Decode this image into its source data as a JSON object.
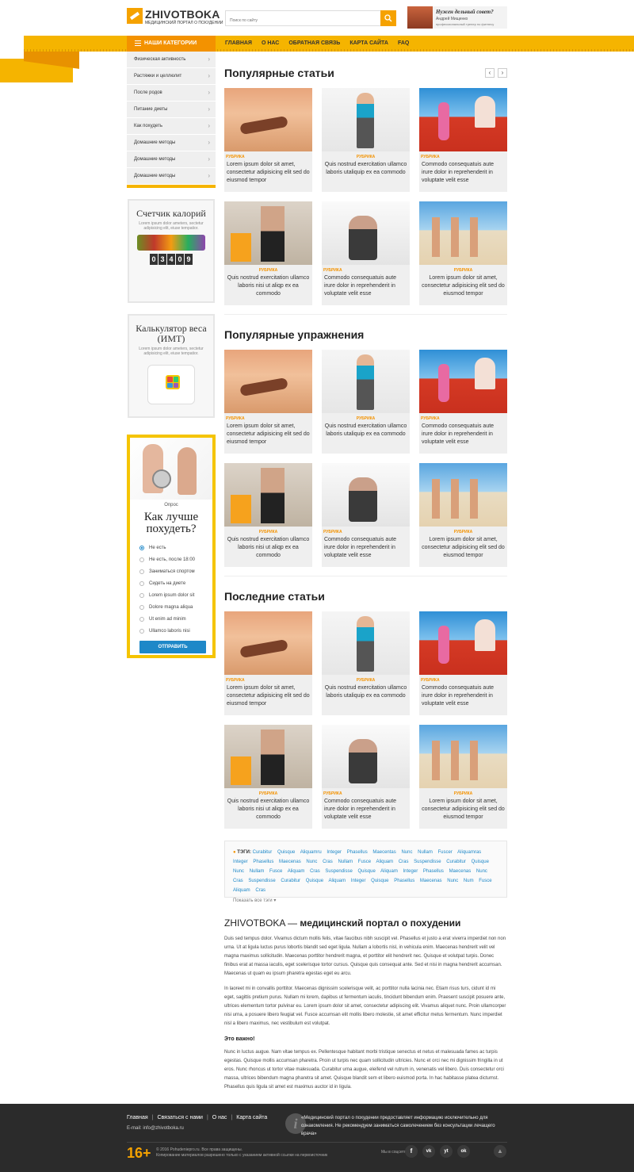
{
  "header": {
    "logo_name": "ZHIVOTBOKA",
    "logo_tagline": "МЕДИЦИНСКИЙ ПОРТАЛ О ПОХУДЕНИИ",
    "search_placeholder": "Поиск по сайту",
    "promo_title": "Нужен дельный совет?",
    "promo_name": "Андрей Мищенко",
    "promo_role": "профессиональный тренер по фитнесу"
  },
  "nav": {
    "categories_label": "НАШИ КАТЕГОРИИ",
    "items": [
      "ГЛАВНАЯ",
      "О НАС",
      "ОБРАТНАЯ СВЯЗЬ",
      "КАРТА САЙТА",
      "FAQ"
    ]
  },
  "categories": [
    "Физическая активность",
    "Растяжки и целлюлит",
    "После родов",
    "Питание диеты",
    "Как похудеть",
    "Домашние методы",
    "Домашние методы",
    "Домашние методы"
  ],
  "widgets": {
    "calories": {
      "title": "Счетчик калорий",
      "desc": "Lorem ipsum dolor ameters, sectetur adipisicing elit, eiuse tempatior.",
      "counter": [
        "0",
        "3",
        "4",
        "0",
        "9"
      ]
    },
    "bmi": {
      "title": "Калькулятор веса (ИМТ)",
      "desc": "Lorem ipsum dolor ameters, sectetur adipisicing elit, eiuse tempatior."
    }
  },
  "poll": {
    "label": "Опрос",
    "question": "Как лучше похудеть?",
    "options": [
      "Не есть",
      "Не есть, после 18:00",
      "Заниматься спортом",
      "Сидеть на диете",
      "Lorem ipsum dolor sit",
      "Dolore magna aliqua",
      "Ut enim ad minim",
      "Ullamco laboris nisi"
    ],
    "selected": 0,
    "submit": "ОТПРАВИТЬ"
  },
  "sections": [
    {
      "title": "Популярные статьи",
      "has_arrows": true
    },
    {
      "title": "Популярные упражнения",
      "has_arrows": false
    },
    {
      "title": "Последние статьи",
      "has_arrows": false
    }
  ],
  "arrows": {
    "prev": "‹",
    "next": "›"
  },
  "cards": [
    {
      "image": "beach",
      "rubric": "РУБРИКА",
      "text": "Lorem ipsum dolor sit amet, consectetur adipisicing elit sed do eiusmod tempor",
      "align": "left"
    },
    {
      "image": "gym",
      "rubric": "РУБРИКА",
      "text": "Quis nostrud exercitation ullamco laboris utaliquip ex ea commodo",
      "align": "center"
    },
    {
      "image": "track",
      "rubric": "РУБРИКА",
      "text": "Commodo consequatuis aute irure dolor in reprehenderit in voluptate velit esse",
      "align": "left"
    },
    {
      "image": "food",
      "rubric": "РУБРИКА",
      "text": "Quis nostrud exercitation ullamco laboris nisi ut aliqp ex ea commodo",
      "align": "center"
    },
    {
      "image": "home",
      "rubric": "РУБРИКА",
      "text": "Commodo consequatuis aute irure dolor in reprehenderit in voluptate velit esse",
      "align": "left"
    },
    {
      "image": "sea",
      "rubric": "РУБРИКА",
      "text": "Lorem ipsum dolor sit amet, consectetur adipisicing elit sed do eiusmod tempor",
      "align": "center"
    }
  ],
  "tags": {
    "label": "ТЭГИ:",
    "items": [
      "Curabitur",
      "Quisque",
      "Aliquamru",
      "Integer",
      "Phasellus",
      "Maecentas",
      "Nunc",
      "Nullam",
      "Fuscer",
      "Aliquamras",
      "Integer",
      "Phasellus",
      "Maecenas",
      "Nunc",
      "Cras",
      "Nullam",
      "Fusce",
      "Aliquam",
      "Cras",
      "Suspendisse",
      "Curabitur",
      "Quisque",
      "Nunc",
      "Nullam",
      "Fusce",
      "Aliquam",
      "Cras",
      "Suspendisse",
      "Quisque",
      "Aliquam",
      "Integer",
      "Phasellus",
      "Maecenas",
      "Nunc",
      "Cras",
      "Suspendisse",
      "Curabitur",
      "Quisque",
      "Aliquam",
      "Integer",
      "Quisque",
      "Phasellus",
      "Maecenas",
      "Nunc",
      "Num",
      "Fusce",
      "Aliquam",
      "Cras"
    ],
    "show_all": "Показать все тэги ▾"
  },
  "about": {
    "title_plain": "ZHIVOTBOKA — ",
    "title_bold": "медицинский портал о похудении",
    "p1": "Duis sed tempus dolor. Vivamus dictum mollis felis, vitae faucibus nibh suscipit vel. Phasellus et justo a erat viverra imperdiet non non urna. Ut at ligula luctus purus lobortis blandit sed eget ligula. Nullam a lobortis nisl, in vehicula enim. Maecenas hendrerit velit vel magna maximus sollicitudin. Maecenas porttitor hendrerit magna, et porttitor elit hendrerit nec. Quisque et volutpat turpis. Donec finibus erat at massa iaculis, eget scelerisque tortor cursus. Quisque quis consequat ante. Sed et nisi in magna hendrerit accumsan. Maecenas ut quam eu ipsum pharetra egestas eget eu arcu.",
    "p2": "In laoreet mi in convallis porttitor. Maecenas dignissim scelerisque velit, ac porttitor nulla lacinia nec. Etiam risus turs, cidunt id mi eget, sagittis pretium purus. Nullam mi lorem, dapibus ut fermentum iaculis, tincidunt bibendum enim. Praesent suscipit posuere ante, ultrices elementum tortor pulvinar eu. Lorem ipsum dolor sit amet, consectetur adipiscing elit. Vivamus aliquet nunc. Proin ullamcorper nisi urna, a posuere libero feugiat vel. Fusce accumsan elit mollis libero molestie, sit amet efficitur metus fermentum. Nunc imperdiet nisl a libero maximus, nec vestibulum est volutpat.",
    "important": "Это важно!",
    "p3": "Nunc in luctus augue. Nam vitae tempus ex. Pellentesque habitant morbi tristique senectus et netus et malesuada fames ac turpis egestas. Quisque mollis accumsan pharetra. Proin ut turpis nec quam sollicitudin ultricies. Nunc et orci nec mi dignissim fringilla in ut eros. Nunc rhoncus ut tortor vitae malesuada. Curabitur urna augue, eleifend vel rutrum in, venenatis vel libero. Duis consectetur orci massa, ultrices bibendum magna pharetra sit amet. Quisque blandit sem et libero euismod porta. In hac habitasse platea dictumst. Phasellus quis ligula sit amet est maximus auctor id in ligula."
  },
  "footer": {
    "links": [
      "Главная",
      "Связаться с нами",
      "О нас",
      "Карта сайта"
    ],
    "email": "E-mail: info@zhivotboka.ru",
    "info": "«Медицинский портал о похудении предоставляет информацию исключительно для ознакомления. Не рекомендуем заниматься самолечением без консультации лечащего врача»",
    "info_icon": "i",
    "age": "16+",
    "copy1": "© 2016 Pohudeniepro.ru. Все права защищены.",
    "copy2": "Копирование материалов разрешено только с указанием активной ссылки на первоисточник",
    "social_label": "Мы в соцсетях ▾",
    "social": [
      "f",
      "vk",
      "yt",
      "ok"
    ],
    "totop": "▲"
  },
  "colors": {
    "accent": "#f5a200",
    "link": "#1e88c8",
    "footer": "#2b2b2b"
  }
}
